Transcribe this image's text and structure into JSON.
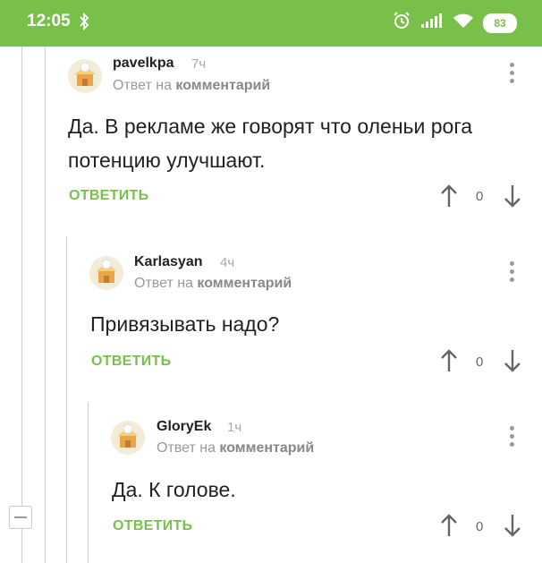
{
  "status_bar": {
    "time": "12:05",
    "battery": "83",
    "accent_color": "#79c04a",
    "icons": [
      "bluetooth-icon",
      "alarm-icon",
      "signal-icon",
      "wifi-icon",
      "battery-icon"
    ]
  },
  "reply_prefix": "Ответ на",
  "reply_target": "комментарий",
  "reply_button_label": "ОТВЕТИТЬ",
  "comments": [
    {
      "author": "pavelkpa",
      "time_ago": "7ч",
      "text_line1": "Да. В рекламе же говорят что оленьи рога",
      "text_line2": "потенцию улучшают.",
      "rating": "0"
    },
    {
      "author": "Karlasyan",
      "time_ago": "4ч",
      "text_line1": "Привязывать надо?",
      "rating": "0"
    },
    {
      "author": "GloryEk",
      "time_ago": "1ч",
      "text_line1": "Да. К голове.",
      "rating": "0"
    }
  ]
}
